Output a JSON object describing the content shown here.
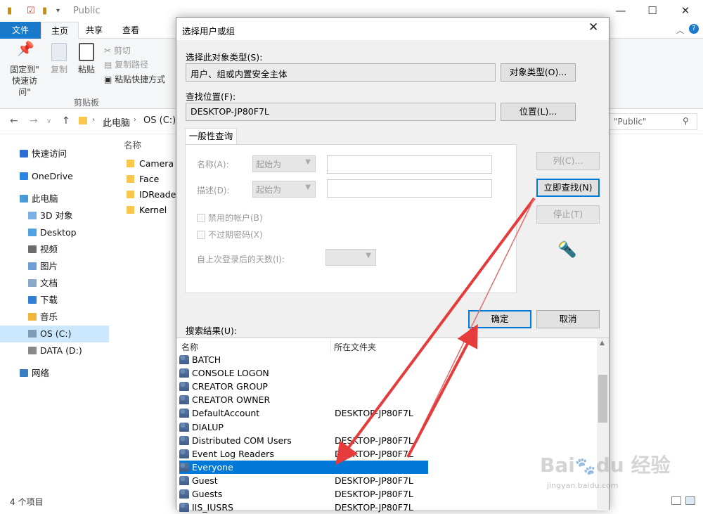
{
  "explorer": {
    "title": "Public",
    "tabs": [
      "文件",
      "主页",
      "共享",
      "查看"
    ],
    "ribbon": {
      "pin_quick_access": "固定到\"\n快速访问\"",
      "pin_line1": "固定到\"",
      "pin_line2": "快速访问\"",
      "copy": "复制",
      "paste": "粘贴",
      "cut": "剪切",
      "copy_path": "复制路径",
      "paste_shortcut": "粘贴快捷方式",
      "group_clipboard": "剪贴板"
    },
    "breadcrumb": [
      "此电脑",
      "OS (C:)"
    ],
    "search_text": "\"Public\"",
    "nav_items": [
      {
        "label": "快速访问",
        "color": "#2a6fd1"
      },
      {
        "label": "OneDrive",
        "color": "#2a86e0"
      },
      {
        "label": "此电脑",
        "color": "#4a9ad8"
      },
      {
        "label": "3D 对象",
        "color": "#7ab0e6"
      },
      {
        "label": "Desktop",
        "color": "#4fa3e3"
      },
      {
        "label": "视频",
        "color": "#6c6c6c"
      },
      {
        "label": "图片",
        "color": "#6d9fd6"
      },
      {
        "label": "文档",
        "color": "#8aa9c9"
      },
      {
        "label": "下载",
        "color": "#2f7fd4"
      },
      {
        "label": "音乐",
        "color": "#f2b43a"
      },
      {
        "label": "OS (C:)",
        "color": "#7e9cb8"
      },
      {
        "label": "DATA (D:)",
        "color": "#888888"
      },
      {
        "label": "网络",
        "color": "#3a7fc4"
      }
    ],
    "file_column_header": "名称",
    "files": [
      "Camera",
      "Face",
      "IDReader",
      "Kernel"
    ],
    "status": "4 个项目"
  },
  "dialog": {
    "title": "选择用户或组",
    "object_type_label": "选择此对象类型(S):",
    "object_type_value": "用户、组或内置安全主体",
    "object_types_button": "对象类型(O)...",
    "location_label": "查找位置(F):",
    "location_value": "DESKTOP-JP80F7L",
    "locations_button": "位置(L)...",
    "query_tab": "一般性查询",
    "name_label": "名称(A):",
    "desc_label": "描述(D):",
    "starts_with": "起始为",
    "disabled_accounts": "禁用的帐户(B)",
    "non_expiring_pw": "不过期密码(X)",
    "days_since_logon": "自上次登录后的天数(I):",
    "columns_button": "列(C)...",
    "find_now_button": "立即查找(N)",
    "stop_button": "停止(T)",
    "ok_button": "确定",
    "cancel_button": "取消",
    "results_label": "搜索结果(U):",
    "results_headers": [
      "名称",
      "所在文件夹"
    ],
    "results": [
      {
        "name": "BATCH",
        "location": ""
      },
      {
        "name": "CONSOLE LOGON",
        "location": ""
      },
      {
        "name": "CREATOR GROUP",
        "location": ""
      },
      {
        "name": "CREATOR OWNER",
        "location": ""
      },
      {
        "name": "DefaultAccount",
        "location": "DESKTOP-JP80F7L"
      },
      {
        "name": "DIALUP",
        "location": ""
      },
      {
        "name": "Distributed COM Users",
        "location": "DESKTOP-JP80F7L"
      },
      {
        "name": "Event Log Readers",
        "location": "DESKTOP-JP80F7L"
      },
      {
        "name": "Everyone",
        "location": ""
      },
      {
        "name": "Guest",
        "location": "DESKTOP-JP80F7L"
      },
      {
        "name": "Guests",
        "location": "DESKTOP-JP80F7L"
      },
      {
        "name": "IIS_IUSRS",
        "location": "DESKTOP-JP80F7L"
      }
    ],
    "selected_result": "Everyone"
  },
  "watermark": {
    "brand": "Bai du 经验",
    "url": "jingyan.baidu.com"
  },
  "colors": {
    "accent": "#0078d7",
    "arrow": "#e53b3b"
  }
}
